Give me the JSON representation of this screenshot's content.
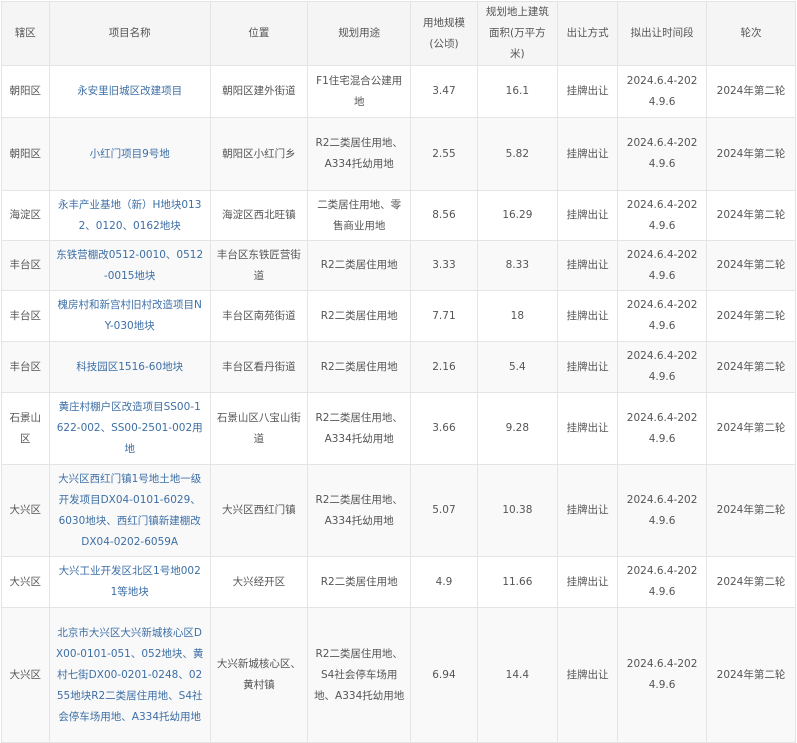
{
  "headers": [
    "辖区",
    "项目名称",
    "位置",
    "规划用途",
    "用地规模(公顷)",
    "规划地上建筑面积(万平方米)",
    "出让方式",
    "拟出让时间段",
    "轮次"
  ],
  "rows": [
    {
      "district": "朝阳区",
      "name": "永安里旧城区改建项目",
      "location": "朝阳区建外街道",
      "usage": "F1住宅混合公建用地",
      "area": "3.47",
      "floor_area": "16.1",
      "method": "挂牌出让",
      "period": "2024.6.4-2024.9.6",
      "round": "2024年第二轮"
    },
    {
      "district": "朝阳区",
      "name": "小红门项目9号地",
      "location": "朝阳区小红门乡",
      "usage": "R2二类居住用地、A334托幼用地",
      "area": "2.55",
      "floor_area": "5.82",
      "method": "挂牌出让",
      "period": "2024.6.4-2024.9.6",
      "round": "2024年第二轮"
    },
    {
      "district": "海淀区",
      "name": "永丰产业基地（新）H地块0132、0120、0162地块",
      "location": "海淀区西北旺镇",
      "usage": "二类居住用地、零售商业用地",
      "area": "8.56",
      "floor_area": "16.29",
      "method": "挂牌出让",
      "period": "2024.6.4-2024.9.6",
      "round": "2024年第二轮"
    },
    {
      "district": "丰台区",
      "name": "东铁营棚改0512-0010、0512-0015地块",
      "location": "丰台区东铁匠营街道",
      "usage": "R2二类居住用地",
      "area": "3.33",
      "floor_area": "8.33",
      "method": "挂牌出让",
      "period": "2024.6.4-2024.9.6",
      "round": "2024年第二轮"
    },
    {
      "district": "丰台区",
      "name": "槐房村和新宫村旧村改造项目NY-030地块",
      "location": "丰台区南苑街道",
      "usage": "R2二类居住用地",
      "area": "7.71",
      "floor_area": "18",
      "method": "挂牌出让",
      "period": "2024.6.4-2024.9.6",
      "round": "2024年第二轮"
    },
    {
      "district": "丰台区",
      "name": "科技园区1516-60地块",
      "location": "丰台区看丹街道",
      "usage": "R2二类居住用地",
      "area": "2.16",
      "floor_area": "5.4",
      "method": "挂牌出让",
      "period": "2024.6.4-2024.9.6",
      "round": "2024年第二轮"
    },
    {
      "district": "石景山区",
      "name": "黄庄村棚户区改造项目SS00-1622-002、SS00-2501-002用地",
      "location": "石景山区八宝山街道",
      "usage": "R2二类居住用地、A334托幼用地",
      "area": "3.66",
      "floor_area": "9.28",
      "method": "挂牌出让",
      "period": "2024.6.4-2024.9.6",
      "round": "2024年第二轮"
    },
    {
      "district": "大兴区",
      "name": "大兴区西红门镇1号地土地一级开发项目DX04-0101-6029、6030地块、西红门镇新建棚改DX04-0202-6059A",
      "location": "大兴区西红门镇",
      "usage": "R2二类居住用地、A334托幼用地",
      "area": "5.07",
      "floor_area": "10.38",
      "method": "挂牌出让",
      "period": "2024.6.4-2024.9.6",
      "round": "2024年第二轮"
    },
    {
      "district": "大兴区",
      "name": "大兴工业开发区北区1号地0021等地块",
      "location": "大兴经开区",
      "usage": "R2二类居住用地",
      "area": "4.9",
      "floor_area": "11.66",
      "method": "挂牌出让",
      "period": "2024.6.4-2024.9.6",
      "round": "2024年第二轮"
    },
    {
      "district": "大兴区",
      "name": "北京市大兴区大兴新城核心区DX00-0101-051、052地块、黄村七街DX00-0201-0248、0255地块R2二类居住用地、S4社会停车场用地、A334托幼用地",
      "location": "大兴新城核心区、黄村镇",
      "usage": "R2二类居住用地、S4社会停车场用地、A334托幼用地",
      "area": "6.94",
      "floor_area": "14.4",
      "method": "挂牌出让",
      "period": "2024.6.4-2024.9.6",
      "round": "2024年第二轮"
    }
  ]
}
